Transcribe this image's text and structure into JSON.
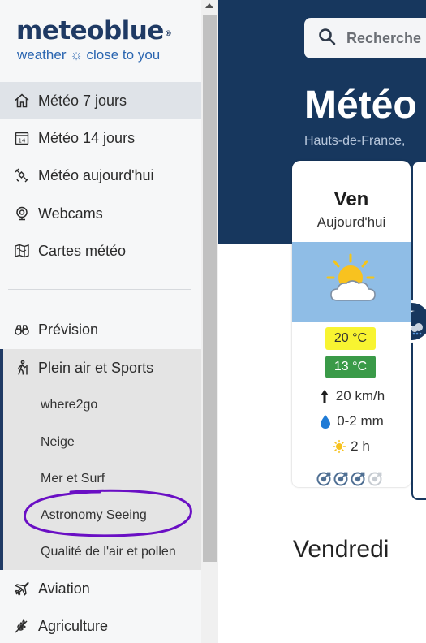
{
  "brand": {
    "name": "meteoblue",
    "registered": "®",
    "tagline": "weather ☼ close to you"
  },
  "nav": {
    "items": [
      {
        "label": "Météo 7 jours",
        "icon": "home-icon",
        "active": true
      },
      {
        "label": "Météo 14 jours",
        "icon": "calendar-14-icon"
      },
      {
        "label": "Météo aujourd'hui",
        "icon": "satellite-icon"
      },
      {
        "label": "Webcams",
        "icon": "webcam-icon"
      },
      {
        "label": "Cartes météo",
        "icon": "map-icon"
      }
    ],
    "secondary": [
      {
        "label": "Prévision",
        "icon": "binoculars-icon"
      },
      {
        "label": "Plein air et Sports",
        "icon": "hiker-icon",
        "expanded": true
      }
    ],
    "sports_sub": [
      {
        "label": "where2go"
      },
      {
        "label": "Neige"
      },
      {
        "label": "Mer et Surf"
      },
      {
        "label": "Astronomy Seeing",
        "annotated": true
      },
      {
        "label": "Qualité de l'air et pollen"
      }
    ],
    "bottom": [
      {
        "label": "Aviation",
        "icon": "airplane-icon"
      },
      {
        "label": "Agriculture",
        "icon": "wheat-icon"
      }
    ]
  },
  "search": {
    "placeholder": "Recherche"
  },
  "page": {
    "title": "Météo",
    "region": "Hauts-de-France, "
  },
  "day_card": {
    "day": "Ven",
    "subtitle": "Aujourd'hui",
    "weather_icon": "sun-cloud-icon",
    "temp_max": "20 °C",
    "temp_min": "13 °C",
    "wind": "20 km/h",
    "precip": "0-2 mm",
    "sunshine": "2 h",
    "predictability_filled": 3,
    "predictability_total": 4
  },
  "section": {
    "title": "Vendredi"
  },
  "colors": {
    "brand_dark": "#1f3a64",
    "hero": "#17375e",
    "active_nav": "#dfe3e8",
    "temp_max": "#f8f431",
    "temp_min": "#3a9a48",
    "annotation": "#6a0fc4"
  }
}
